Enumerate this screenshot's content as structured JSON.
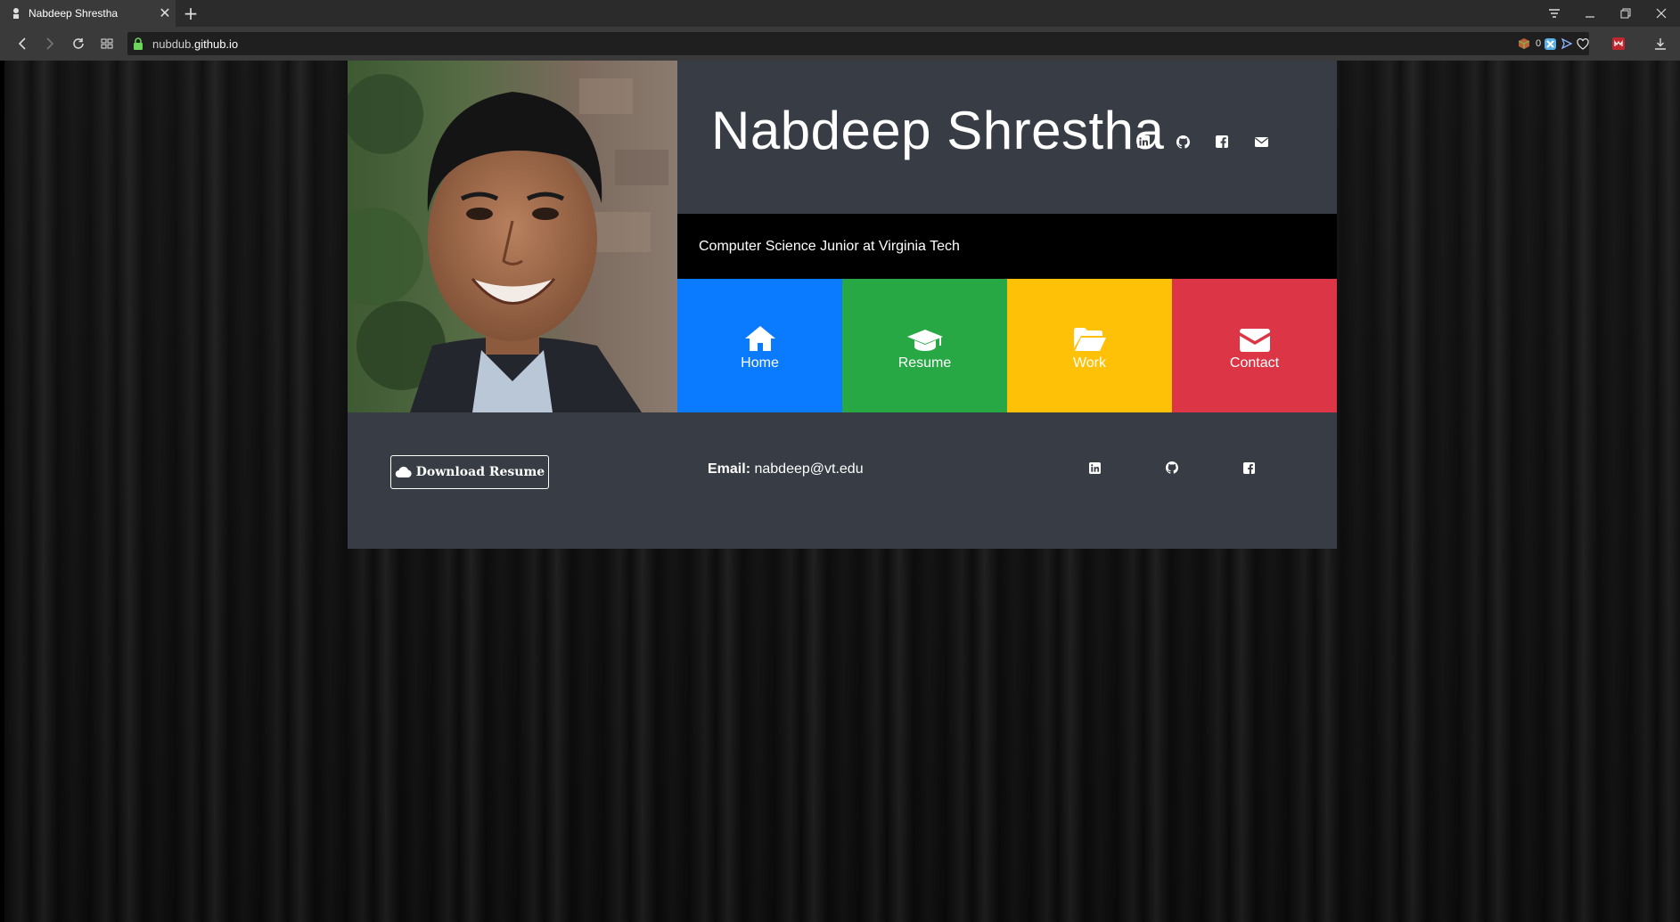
{
  "browser": {
    "tab_title": "Nabdeep Shrestha",
    "tab_close": "✕",
    "new_tab": "+",
    "url_prefix": "nubdub.",
    "url_host": "github.io",
    "extension_counter": "0"
  },
  "profile": {
    "name": "Nabdeep Shrestha",
    "tagline": "Computer Science Junior at Virginia Tech"
  },
  "nav_tiles": [
    {
      "label": "Home",
      "color": "#0a7bff",
      "icon": "home-icon"
    },
    {
      "label": "Resume",
      "color": "#28a745",
      "icon": "graduation-cap-icon"
    },
    {
      "label": "Work",
      "color": "#ffc107",
      "icon": "folder-open-icon"
    },
    {
      "label": "Contact",
      "color": "#dc3545",
      "icon": "envelope-icon"
    }
  ],
  "header_social": [
    "linkedin-icon",
    "github-icon",
    "facebook-icon",
    "envelope-icon"
  ],
  "footer": {
    "download_label": "Download Resume",
    "email_label": "Email:",
    "email_value": "nabdeep@vt.edu",
    "social": [
      "linkedin-icon",
      "github-icon",
      "facebook-icon"
    ]
  },
  "colors": {
    "panel": "#383c44",
    "tagline_bg": "#000000"
  }
}
